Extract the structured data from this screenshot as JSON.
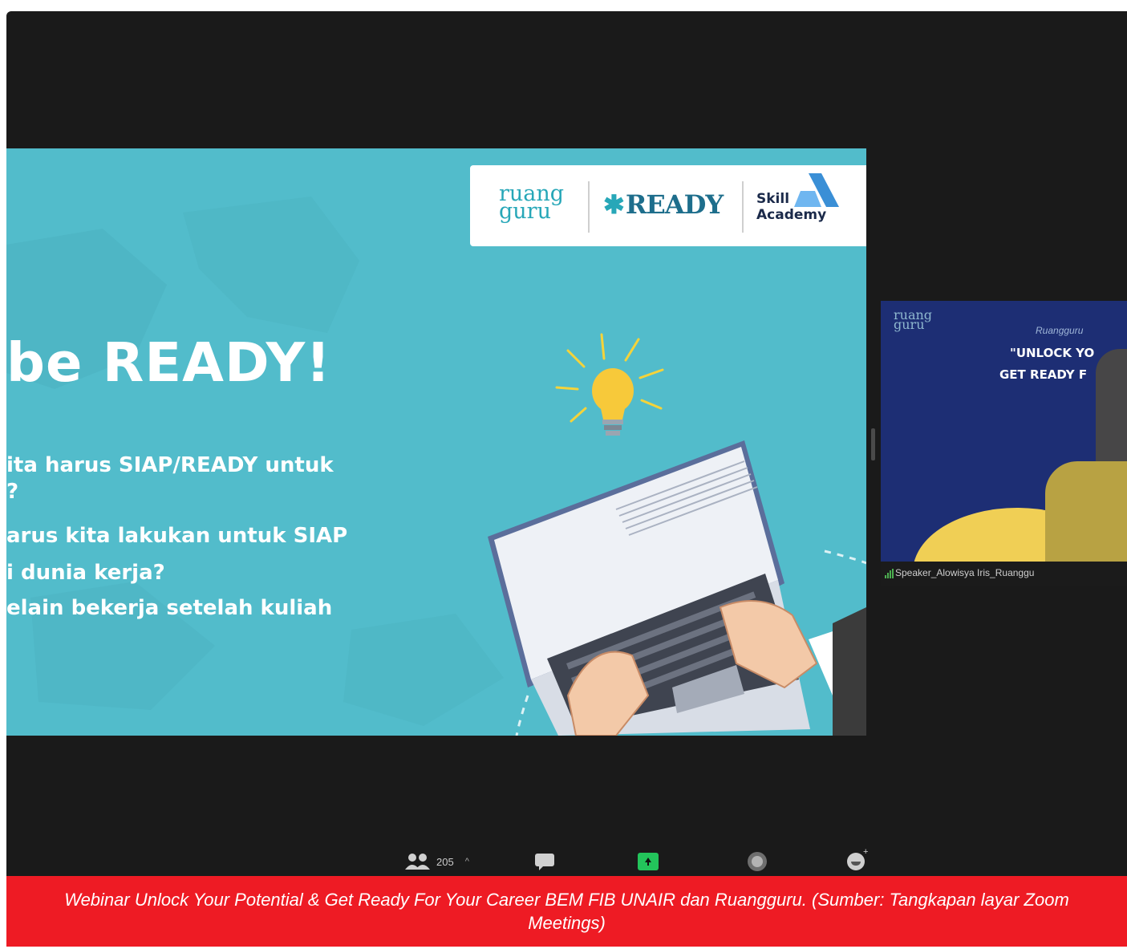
{
  "slide": {
    "logos": {
      "ruangguru": [
        "ruang",
        "guru"
      ],
      "ready": "READY",
      "skill_academy": [
        "Skill",
        "Academy"
      ]
    },
    "headline": "be READY!",
    "bullets": [
      "ita harus SIAP/READY untuk",
      "?",
      "arus kita lakukan untuk SIAP",
      "i dunia kerja?",
      "elain bekerja setelah kuliah"
    ]
  },
  "speaker_tile": {
    "logo": [
      "ruang",
      "guru"
    ],
    "org": "Ruangguru",
    "title_line1": "\"UNLOCK YO",
    "title_line2": "GET READY F",
    "name": "Speaker_Alowisya Iris_Ruanggu"
  },
  "toolbar": {
    "participants_count": "205",
    "participants_caret": "^",
    "icons": [
      "participants-icon",
      "chat-icon",
      "share-screen-icon",
      "record-icon",
      "reactions-icon"
    ],
    "share_color": "#23c45b"
  },
  "caption": "Webinar Unlock Your Potential & Get Ready For Your Career BEM FIB UNAIR dan Ruangguru. (Sumber: Tangkapan layar Zoom Meetings)",
  "colors": {
    "slide_background": "#52bccb",
    "caption_background": "#ee1b24",
    "window_background": "#1a1a1a",
    "tile_background": "#1d2e74"
  }
}
